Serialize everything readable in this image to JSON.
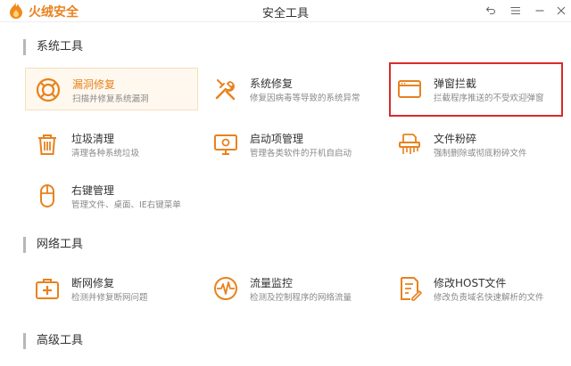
{
  "titlebar": {
    "brand": "火绒安全",
    "title": "安全工具",
    "icons": [
      "back-icon",
      "menu-icon",
      "minimize-icon",
      "close-icon"
    ]
  },
  "sections": {
    "system": "系统工具",
    "network": "网络工具",
    "advanced": "高级工具"
  },
  "tools": {
    "vuln_repair": {
      "name": "漏洞修复",
      "desc": "扫描并修复系统漏洞",
      "icon": "lifebuoy-icon"
    },
    "sys_repair": {
      "name": "系统修复",
      "desc": "修复因病毒等导致的系统异常",
      "icon": "wrench-icon"
    },
    "popup_block": {
      "name": "弹窗拦截",
      "desc": "拦截程序推送的不受欢迎弹窗",
      "icon": "window-icon"
    },
    "junk_clean": {
      "name": "垃圾清理",
      "desc": "清理各种系统垃圾",
      "icon": "trash-icon"
    },
    "startup_mgr": {
      "name": "启动项管理",
      "desc": "管理各类软件的开机自启动",
      "icon": "monitor-icon"
    },
    "file_shred": {
      "name": "文件粉碎",
      "desc": "强制删除或彻底粉碎文件",
      "icon": "shredder-icon"
    },
    "rightclick_mgr": {
      "name": "右键管理",
      "desc": "管理文件、桌面、IE右键菜单",
      "icon": "mouse-icon"
    },
    "net_repair": {
      "name": "断网修复",
      "desc": "检测并修复断网问题",
      "icon": "first-aid-icon"
    },
    "traffic_mon": {
      "name": "流量监控",
      "desc": "检测及控制程序的网络流量",
      "icon": "pulse-icon"
    },
    "hosts_edit": {
      "name": "修改HOST文件",
      "desc": "修改负责域名快速解析的文件",
      "icon": "edit-file-icon"
    }
  },
  "colors": {
    "accent": "#e8821e",
    "highlight": "#d92b2b"
  }
}
